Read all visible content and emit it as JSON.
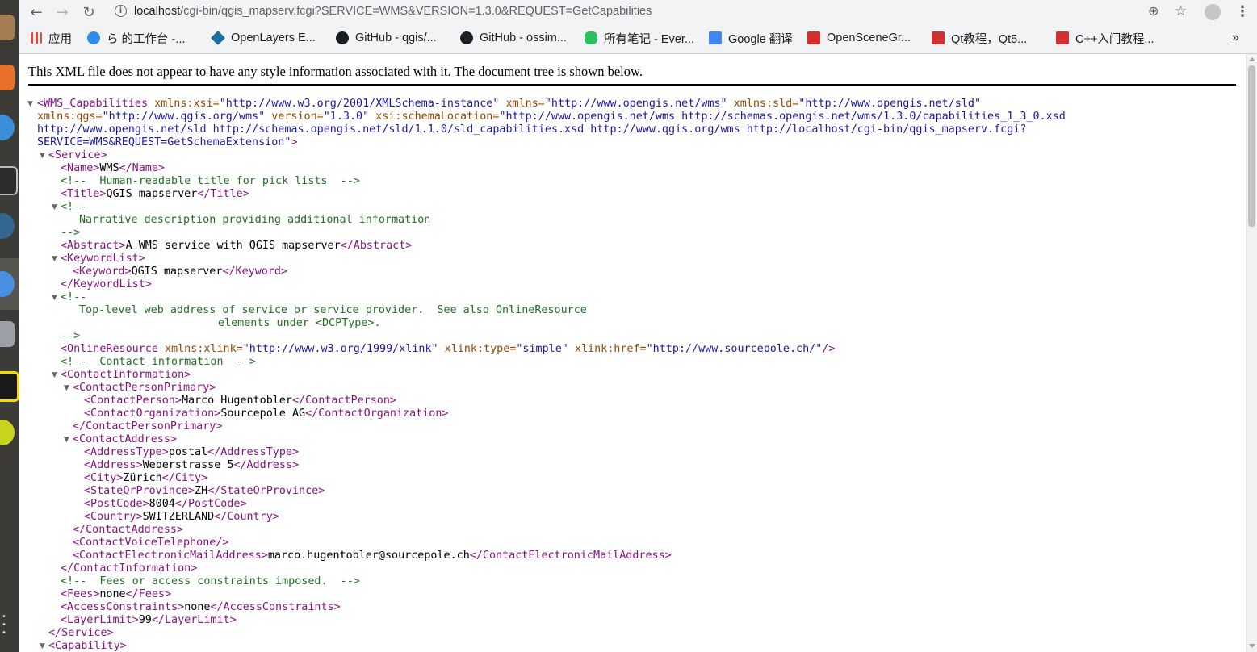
{
  "browser": {
    "url_host": "localhost",
    "url_rest": "/cgi-bin/qgis_mapserv.fcgi?SERVICE=WMS&VERSION=1.3.0&REQUEST=GetCapabilities",
    "back_icon": "←",
    "forward_icon": "→",
    "reload_icon": "↻",
    "zoom_icon": "⊕",
    "star_icon": "☆",
    "menu_icon": "⋮",
    "more_bookmarks_icon": "»"
  },
  "bookmarks": [
    {
      "label": "应用",
      "color": "#e8453c"
    },
    {
      "label": "ら 的工作台 -...",
      "color": "#2b8fe8"
    },
    {
      "label": "OpenLayers E...",
      "color": "#1f6f9e"
    },
    {
      "label": "GitHub - qgis/...",
      "color": "#1b1f23"
    },
    {
      "label": "GitHub - ossim...",
      "color": "#1b1f23"
    },
    {
      "label": "所有笔记 - Ever...",
      "color": "#2dbe60"
    },
    {
      "label": "Google 翻译",
      "color": "#4285f4"
    },
    {
      "label": "OpenSceneGr...",
      "color": "#d32f2f"
    },
    {
      "label": "Qt教程，Qt5...",
      "color": "#d32f2f"
    },
    {
      "label": "C++入门教程...",
      "color": "#d32f2f"
    }
  ],
  "notice": "This XML file does not appear to have any style information associated with it. The document tree is shown below.",
  "xml": {
    "root_open": "<WMS_Capabilities",
    "root_attrs": [
      {
        "n": "xmlns:xsi=",
        "v": "\"http://www.w3.org/2001/XMLSchema-instance\""
      },
      {
        "n": "xmlns=",
        "v": "\"http://www.opengis.net/wms\""
      },
      {
        "n": "xmlns:sld=",
        "v": "\"http://www.opengis.net/sld\""
      },
      {
        "n": "xmlns:qgs=",
        "v": "\"http://www.qgis.org/wms\""
      },
      {
        "n": "version=",
        "v": "\"1.3.0\""
      },
      {
        "n": "xsi:schemaLocation=",
        "v": "\"http://www.opengis.net/wms http://schemas.opengis.net/wms/1.3.0/capabilities_1_3_0.xsd"
      },
      {
        "v": "http://www.opengis.net/sld http://schemas.opengis.net/sld/1.1.0/sld_capabilities.xsd http://www.qgis.org/wms http://localhost/cgi-bin/qgis_mapserv.fcgi?"
      },
      {
        "v": "SERVICE=WMS&REQUEST=GetSchemaExtension\""
      }
    ],
    "root_close_bracket": ">",
    "service_open": "<Service>",
    "name_open": "<Name>",
    "name_val": "WMS",
    "name_close": "</Name>",
    "comment_title": "<!--  Human-readable title for pick lists  -->",
    "title_open": "<Title>",
    "title_val": "QGIS mapserver",
    "title_close": "</Title>",
    "comment_open": "<!--",
    "comment_narrative": "Narrative description providing additional information",
    "comment_close": "-->",
    "abstract_open": "<Abstract>",
    "abstract_val": "A WMS service with QGIS mapserver",
    "abstract_close": "</Abstract>",
    "keywordlist_open": "<KeywordList>",
    "keyword_open": "<Keyword>",
    "keyword_val": "QGIS mapserver",
    "keyword_close": "</Keyword>",
    "keywordlist_close": "</KeywordList>",
    "comment_toplevel_1": "Top-level web address of service or service provider.  See also OnlineResource",
    "comment_toplevel_2": "elements under <DCPType>.",
    "onlineresource_open": "<OnlineResource",
    "onlineresource_attrs": [
      {
        "n": "xmlns:xlink=",
        "v": "\"http://www.w3.org/1999/xlink\""
      },
      {
        "n": "xlink:type=",
        "v": "\"simple\""
      },
      {
        "n": "xlink:href=",
        "v": "\"http://www.sourcepole.ch/\""
      }
    ],
    "selfclose": "/>",
    "comment_contact": "<!--  Contact information  -->",
    "contactinfo_open": "<ContactInformation>",
    "cpp_open": "<ContactPersonPrimary>",
    "cperson_open": "<ContactPerson>",
    "cperson_val": "Marco Hugentobler",
    "cperson_close": "</ContactPerson>",
    "corg_open": "<ContactOrganization>",
    "corg_val": "Sourcepole AG",
    "corg_close": "</ContactOrganization>",
    "cpp_close": "</ContactPersonPrimary>",
    "caddr_open": "<ContactAddress>",
    "atype_open": "<AddressType>",
    "atype_val": "postal",
    "atype_close": "</AddressType>",
    "addr_open": "<Address>",
    "addr_val": "Weberstrasse 5",
    "addr_close": "</Address>",
    "city_open": "<City>",
    "city_val": "Zürich",
    "city_close": "</City>",
    "state_open": "<StateOrProvince>",
    "state_val": "ZH",
    "state_close": "</StateOrProvince>",
    "post_open": "<PostCode>",
    "post_val": "8004",
    "post_close": "</PostCode>",
    "country_open": "<Country>",
    "country_val": "SWITZERLAND",
    "country_close": "</Country>",
    "caddr_close": "</ContactAddress>",
    "voice": "<ContactVoiceTelephone/>",
    "email_open": "<ContactElectronicMailAddress>",
    "email_val": "marco.hugentobler@sourcepole.ch",
    "email_close": "</ContactElectronicMailAddress>",
    "contactinfo_close": "</ContactInformation>",
    "comment_fees": "<!--  Fees or access constraints imposed.  -->",
    "fees_open": "<Fees>",
    "fees_val": "none",
    "fees_close": "</Fees>",
    "access_open": "<AccessConstraints>",
    "access_val": "none",
    "access_close": "</AccessConstraints>",
    "layerlimit_open": "<LayerLimit>",
    "layerlimit_val": "99",
    "layerlimit_close": "</LayerLimit>",
    "service_close": "</Service>",
    "capability_open": "<Capability>"
  }
}
